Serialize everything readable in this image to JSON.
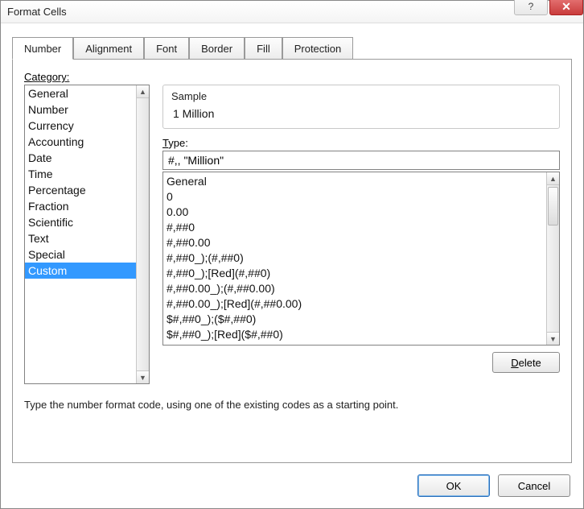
{
  "window": {
    "title": "Format Cells",
    "help_symbol": "?",
    "close_symbol": "✕"
  },
  "tabs": [
    {
      "label": "Number",
      "active": true
    },
    {
      "label": "Alignment",
      "active": false
    },
    {
      "label": "Font",
      "active": false
    },
    {
      "label": "Border",
      "active": false
    },
    {
      "label": "Fill",
      "active": false
    },
    {
      "label": "Protection",
      "active": false
    }
  ],
  "category": {
    "label": "Category:",
    "items": [
      "General",
      "Number",
      "Currency",
      "Accounting",
      "Date",
      "Time",
      "Percentage",
      "Fraction",
      "Scientific",
      "Text",
      "Special",
      "Custom"
    ],
    "selected_index": 11
  },
  "sample": {
    "label": "Sample",
    "value": "1 Million"
  },
  "type": {
    "label": "Type:",
    "value": "#,, \"Million\""
  },
  "format_list": [
    "General",
    "0",
    "0.00",
    "#,##0",
    "#,##0.00",
    "#,##0_);(#,##0)",
    "#,##0_);[Red](#,##0)",
    "#,##0.00_);(#,##0.00)",
    "#,##0.00_);[Red](#,##0.00)",
    "$#,##0_);($#,##0)",
    "$#,##0_);[Red]($#,##0)"
  ],
  "buttons": {
    "delete": "Delete",
    "ok": "OK",
    "cancel": "Cancel"
  },
  "hint": "Type the number format code, using one of the existing codes as a starting point."
}
